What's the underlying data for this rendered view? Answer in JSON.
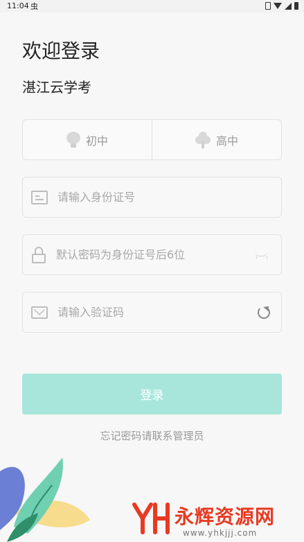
{
  "status_bar": {
    "time": "11:04",
    "app_indicator": "虫"
  },
  "header": {
    "title": "欢迎登录",
    "subtitle": "湛江云学考"
  },
  "level_switch": {
    "options": [
      {
        "label": "初中",
        "icon": "bulb-icon"
      },
      {
        "label": "高中",
        "icon": "tree-icon"
      }
    ]
  },
  "form": {
    "id_number": {
      "placeholder": "请输入身份证号",
      "value": ""
    },
    "password": {
      "placeholder": "默认密码为身份证号后6位",
      "value": ""
    },
    "captcha": {
      "placeholder": "请输入验证码",
      "value": ""
    }
  },
  "actions": {
    "login_label": "登录",
    "forgot_label": "忘记密码请联系管理员"
  },
  "watermark": {
    "title": "永辉资源网",
    "url": "www.yhkjjj.com"
  },
  "colors": {
    "accent": "#a8e6dc",
    "watermark_red": "#e83a22",
    "background": "#f7f7f7"
  }
}
